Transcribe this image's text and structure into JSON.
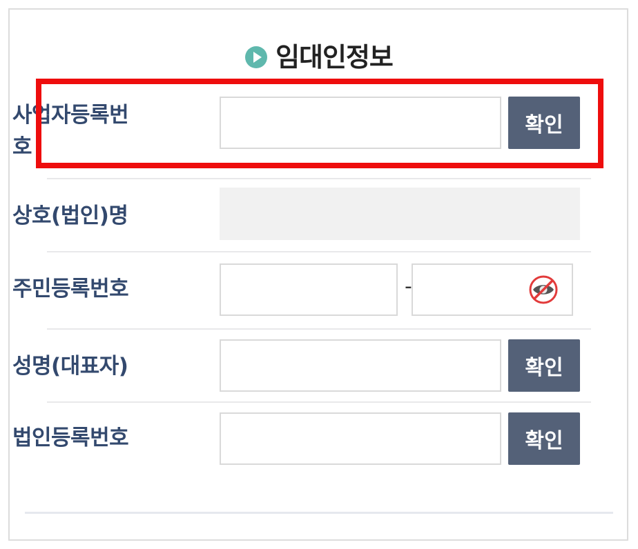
{
  "section": {
    "title": "임대인정보"
  },
  "rows": {
    "business_reg": {
      "label_line1": "사업자등록번",
      "label_line2": "호",
      "button": "확인"
    },
    "company_name": {
      "label": "상호(법인)명"
    },
    "resident_reg": {
      "label": "주민등록번호",
      "separator": "-",
      "visibility_icon": "eye-slash-icon"
    },
    "representative": {
      "label": "성명(대표자)",
      "button": "확인"
    },
    "corp_reg": {
      "label": "법인등록번호",
      "button": "확인"
    }
  },
  "colors": {
    "label": "#33496e",
    "button_bg": "#546178",
    "highlight": "#ee0d0d",
    "title_icon": "#5fb8ad"
  }
}
